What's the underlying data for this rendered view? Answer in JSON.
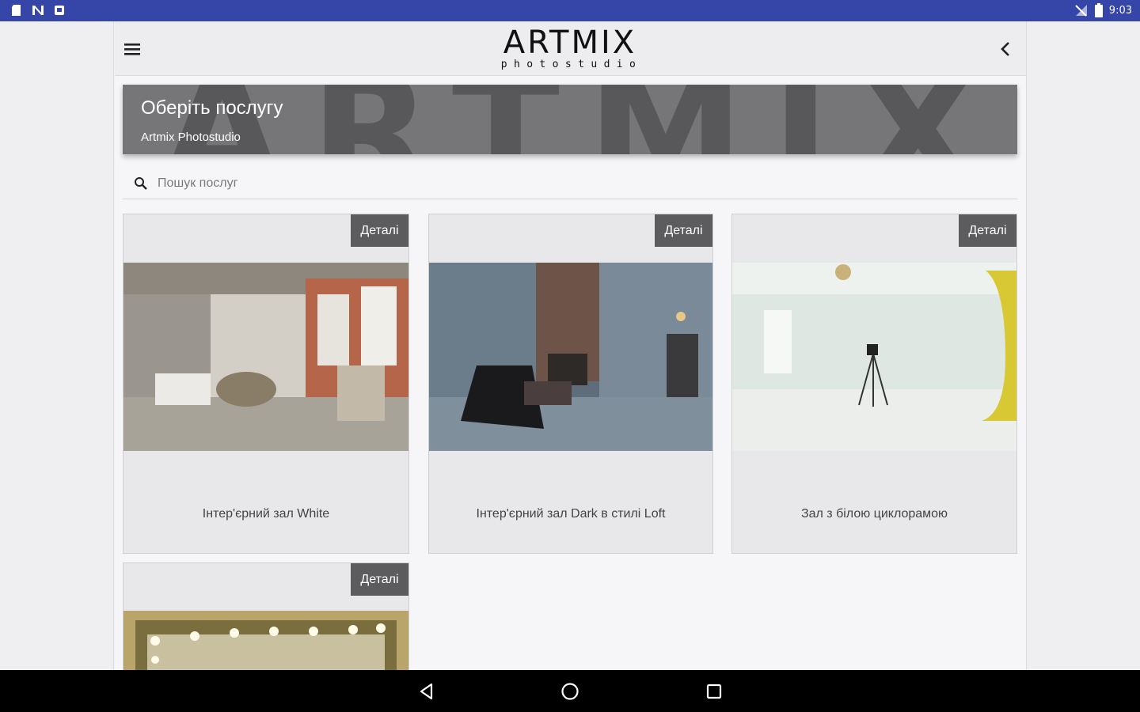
{
  "status_bar": {
    "time": "9:03",
    "icons": [
      "sd-card-icon",
      "n-icon",
      "notification-icon",
      "no-signal-icon",
      "battery-icon"
    ]
  },
  "toolbar": {
    "logo_main": "ARTMIX",
    "logo_sub": "photostudio",
    "menu_icon": "hamburger-menu-icon",
    "back_icon": "chevron-left-icon"
  },
  "banner": {
    "watermark": "ARTMIX",
    "title": "Оберіть послугу",
    "subtitle": "Artmix Photostudio"
  },
  "search": {
    "placeholder": "Пошук послуг",
    "value": ""
  },
  "cards": [
    {
      "details_label": "Деталі",
      "title": "Інтер'єрний зал White"
    },
    {
      "details_label": "Деталі",
      "title": "Інтер'єрний зал Dark в стилі Loft"
    },
    {
      "details_label": "Деталі",
      "title": "Зал з білою циклорамою"
    },
    {
      "details_label": "Деталі",
      "title": ""
    }
  ],
  "nav_bar": {
    "back_icon": "nav-back-icon",
    "home_icon": "nav-home-icon",
    "recents_icon": "nav-recents-icon"
  },
  "colors": {
    "status_bar": "#3646a8",
    "banner": "#767678",
    "details_button": "#5c5c5e",
    "card": "#e8e8eb"
  }
}
